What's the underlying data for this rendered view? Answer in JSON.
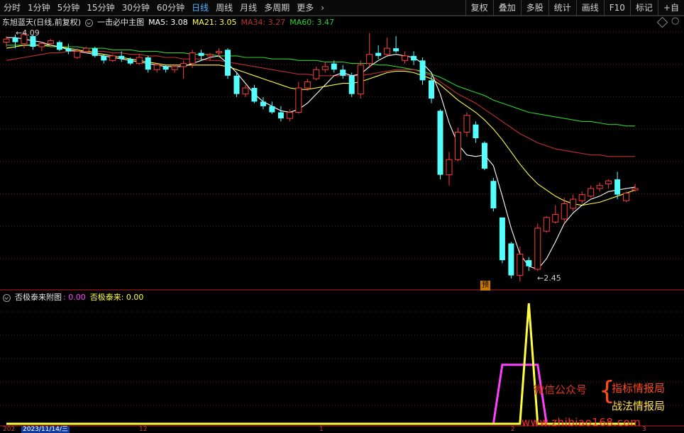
{
  "toolbar": {
    "periods": [
      "分时",
      "1分钟",
      "5分钟",
      "15分钟",
      "30分钟",
      "60分钟",
      "日线",
      "周线",
      "月线",
      "多周期",
      "更多"
    ],
    "active_period": "日线",
    "right_buttons": [
      "复权",
      "叠加",
      "多股",
      "统计",
      "画线",
      "F10",
      "标记",
      "+自"
    ]
  },
  "main_info": {
    "stock": "东旭蓝天(日线,前复权)",
    "indicator": "一击必中主图",
    "ma5": "MA5: 3.08",
    "ma21": "MA21: 3.05",
    "ma34": "MA34: 3.27",
    "ma60": "MA60: 3.47",
    "high_label": "4.09",
    "low_label": "2.45",
    "pre_badge": "预",
    "colors": {
      "ma5": "#ffffff",
      "ma21": "#ffff40",
      "ma34": "#c03030",
      "ma60": "#30d030"
    }
  },
  "sub_info": {
    "title": "否极泰来附图",
    "v1": ": 0.00",
    "v2_label": "否极泰来",
    "v2": ": 0.00",
    "colors": {
      "v1": "#ff40ff",
      "v2": "#ffff40"
    }
  },
  "watermark": {
    "wechat": "微信公众号",
    "l1": "指标情报局",
    "l2": "战法情报局",
    "url": "www.zhibiao168.com"
  },
  "axis": {
    "date_cursor": "2023/11/14/三",
    "partial_year": "202",
    "x_labels": [
      "12",
      "1",
      "2",
      "3"
    ]
  },
  "chart_data": {
    "type": "candlestick",
    "candles": [
      [
        4.02,
        4.06,
        3.99,
        4.04
      ],
      [
        4.05,
        4.07,
        3.98,
        4.02
      ],
      [
        4.01,
        4.09,
        3.98,
        4.07
      ],
      [
        4.06,
        4.07,
        3.97,
        3.99
      ],
      [
        3.99,
        4.02,
        3.96,
        4.01
      ],
      [
        4.01,
        4.04,
        3.99,
        4.03
      ],
      [
        4.02,
        4.03,
        3.96,
        3.97
      ],
      [
        3.98,
        4.01,
        3.94,
        3.96
      ],
      [
        3.92,
        3.98,
        3.91,
        3.96
      ],
      [
        3.96,
        3.99,
        3.95,
        3.98
      ],
      [
        3.98,
        3.99,
        3.92,
        3.93
      ],
      [
        3.93,
        3.94,
        3.88,
        3.9
      ],
      [
        3.9,
        3.94,
        3.89,
        3.93
      ],
      [
        3.93,
        3.96,
        3.89,
        3.91
      ],
      [
        3.91,
        3.92,
        3.87,
        3.88
      ],
      [
        3.88,
        3.94,
        3.87,
        3.92
      ],
      [
        3.92,
        3.93,
        3.82,
        3.84
      ],
      [
        3.84,
        3.88,
        3.82,
        3.87
      ],
      [
        3.86,
        3.87,
        3.82,
        3.84
      ],
      [
        3.84,
        3.87,
        3.82,
        3.86
      ],
      [
        3.86,
        3.9,
        3.78,
        3.88
      ],
      [
        3.88,
        3.97,
        3.85,
        3.95
      ],
      [
        3.95,
        3.97,
        3.9,
        3.93
      ],
      [
        3.93,
        3.95,
        3.9,
        3.94
      ],
      [
        3.95,
        3.98,
        3.92,
        3.96
      ],
      [
        3.97,
        3.98,
        3.78,
        3.8
      ],
      [
        3.8,
        3.82,
        3.66,
        3.68
      ],
      [
        3.68,
        3.74,
        3.66,
        3.72
      ],
      [
        3.72,
        3.74,
        3.62,
        3.63
      ],
      [
        3.63,
        3.66,
        3.58,
        3.6
      ],
      [
        3.6,
        3.63,
        3.55,
        3.56
      ],
      [
        3.56,
        3.6,
        3.5,
        3.52
      ],
      [
        3.52,
        3.58,
        3.5,
        3.56
      ],
      [
        3.56,
        3.76,
        3.55,
        3.72
      ],
      [
        3.72,
        3.78,
        3.7,
        3.76
      ],
      [
        3.78,
        3.86,
        3.77,
        3.84
      ],
      [
        3.84,
        3.89,
        3.82,
        3.86
      ],
      [
        3.88,
        3.9,
        3.82,
        3.84
      ],
      [
        3.84,
        3.87,
        3.78,
        3.8
      ],
      [
        3.8,
        3.82,
        3.66,
        3.68
      ],
      [
        3.68,
        3.9,
        3.65,
        3.87
      ],
      [
        3.88,
        4.08,
        3.85,
        3.94
      ],
      [
        3.95,
        4.0,
        3.91,
        3.93
      ],
      [
        3.94,
        4.05,
        3.93,
        3.98
      ],
      [
        3.98,
        4.06,
        3.95,
        3.96
      ],
      [
        3.9,
        3.96,
        3.88,
        3.93
      ],
      [
        3.93,
        3.96,
        3.87,
        3.9
      ],
      [
        3.9,
        3.92,
        3.74,
        3.77
      ],
      [
        3.77,
        3.8,
        3.62,
        3.65
      ],
      [
        3.57,
        3.58,
        3.12,
        3.15
      ],
      [
        3.15,
        3.3,
        3.08,
        3.25
      ],
      [
        3.25,
        3.46,
        3.24,
        3.43
      ],
      [
        3.43,
        3.56,
        3.4,
        3.54
      ],
      [
        3.48,
        3.5,
        3.36,
        3.39
      ],
      [
        3.36,
        3.37,
        3.18,
        3.19
      ],
      [
        3.11,
        3.13,
        2.91,
        2.93
      ],
      [
        2.87,
        2.87,
        2.57,
        2.59
      ],
      [
        2.7,
        2.71,
        2.47,
        2.49
      ],
      [
        2.49,
        2.68,
        2.45,
        2.63
      ],
      [
        2.59,
        2.61,
        2.52,
        2.55
      ],
      [
        2.53,
        2.83,
        2.52,
        2.8
      ],
      [
        2.78,
        2.88,
        2.77,
        2.87
      ],
      [
        2.84,
        2.95,
        2.83,
        2.89
      ],
      [
        2.86,
        3.0,
        2.84,
        2.96
      ],
      [
        2.93,
        3.02,
        2.91,
        2.99
      ],
      [
        2.98,
        3.04,
        2.96,
        3.02
      ],
      [
        3.01,
        3.08,
        3.0,
        3.06
      ],
      [
        3.06,
        3.1,
        3.04,
        3.08
      ],
      [
        3.09,
        3.12,
        3.06,
        3.11
      ],
      [
        3.12,
        3.17,
        2.99,
        3.02
      ],
      [
        2.98,
        3.04,
        2.97,
        3.03
      ],
      [
        3.05,
        3.09,
        3.04,
        3.06
      ]
    ],
    "ma5": [
      4.05,
      4.05,
      4.04,
      4.03,
      4.02,
      4.0,
      3.99,
      3.97,
      3.96,
      3.95,
      3.94,
      3.93,
      3.92,
      3.91,
      3.9,
      3.89,
      3.88,
      3.87,
      3.86,
      3.86,
      3.86,
      3.88,
      3.9,
      3.92,
      3.93,
      3.88,
      3.82,
      3.75,
      3.68,
      3.63,
      3.6,
      3.57,
      3.56,
      3.58,
      3.62,
      3.68,
      3.74,
      3.8,
      3.82,
      3.8,
      3.81,
      3.86,
      3.9,
      3.93,
      3.94,
      3.93,
      3.92,
      3.88,
      3.82,
      3.68,
      3.49,
      3.35,
      3.28,
      3.27,
      3.28,
      3.21,
      3.01,
      2.8,
      2.63,
      2.55,
      2.53,
      2.6,
      2.71,
      2.83,
      2.9,
      2.95,
      2.99,
      3.01,
      3.04,
      3.05,
      3.06,
      3.07
    ],
    "ma21": [
      3.98,
      3.99,
      4.0,
      4.0,
      4.0,
      4.0,
      3.99,
      3.98,
      3.97,
      3.96,
      3.95,
      3.94,
      3.93,
      3.92,
      3.91,
      3.9,
      3.89,
      3.88,
      3.87,
      3.87,
      3.87,
      3.87,
      3.87,
      3.87,
      3.87,
      3.86,
      3.84,
      3.82,
      3.8,
      3.78,
      3.76,
      3.74,
      3.72,
      3.71,
      3.71,
      3.72,
      3.73,
      3.74,
      3.75,
      3.75,
      3.76,
      3.78,
      3.8,
      3.82,
      3.83,
      3.83,
      3.82,
      3.8,
      3.78,
      3.74,
      3.69,
      3.64,
      3.6,
      3.56,
      3.51,
      3.45,
      3.38,
      3.3,
      3.22,
      3.15,
      3.09,
      3.05,
      3.01,
      2.98,
      2.96,
      2.95,
      2.96,
      2.97,
      2.99,
      3.01,
      3.03,
      3.05
    ],
    "ma34": [
      3.9,
      3.91,
      3.92,
      3.93,
      3.94,
      3.95,
      3.95,
      3.96,
      3.96,
      3.96,
      3.96,
      3.96,
      3.95,
      3.95,
      3.94,
      3.94,
      3.93,
      3.93,
      3.92,
      3.92,
      3.91,
      3.91,
      3.91,
      3.9,
      3.9,
      3.89,
      3.88,
      3.87,
      3.86,
      3.85,
      3.84,
      3.83,
      3.82,
      3.81,
      3.81,
      3.8,
      3.8,
      3.8,
      3.8,
      3.8,
      3.8,
      3.81,
      3.82,
      3.83,
      3.84,
      3.84,
      3.84,
      3.82,
      3.8,
      3.76,
      3.72,
      3.68,
      3.65,
      3.62,
      3.58,
      3.54,
      3.5,
      3.46,
      3.42,
      3.39,
      3.36,
      3.34,
      3.32,
      3.31,
      3.3,
      3.29,
      3.28,
      3.28,
      3.27,
      3.27,
      3.27,
      3.27
    ],
    "ma60": [
      4.0,
      4.0,
      4.0,
      4.0,
      4.0,
      3.99,
      3.99,
      3.99,
      3.99,
      3.98,
      3.98,
      3.98,
      3.97,
      3.97,
      3.97,
      3.96,
      3.96,
      3.96,
      3.95,
      3.95,
      3.95,
      3.94,
      3.94,
      3.94,
      3.93,
      3.93,
      3.93,
      3.92,
      3.92,
      3.92,
      3.91,
      3.91,
      3.91,
      3.9,
      3.9,
      3.9,
      3.89,
      3.89,
      3.89,
      3.88,
      3.88,
      3.88,
      3.87,
      3.87,
      3.86,
      3.85,
      3.84,
      3.83,
      3.81,
      3.79,
      3.76,
      3.73,
      3.71,
      3.69,
      3.67,
      3.64,
      3.62,
      3.6,
      3.58,
      3.56,
      3.55,
      3.54,
      3.53,
      3.52,
      3.51,
      3.5,
      3.5,
      3.49,
      3.48,
      3.48,
      3.47,
      3.47
    ],
    "sub": {
      "magenta": [
        0,
        0,
        0,
        0,
        0,
        0,
        0,
        0,
        0,
        0,
        0,
        0,
        0,
        0,
        0,
        0,
        0,
        0,
        0,
        0,
        0,
        0,
        0,
        0,
        0,
        0,
        0,
        0,
        0,
        0,
        0,
        0,
        0,
        0,
        0,
        0,
        0,
        0,
        0,
        0,
        0,
        0,
        0,
        0,
        0,
        0,
        0,
        0,
        0,
        0,
        0,
        0,
        0,
        0,
        0,
        0,
        0.49,
        0.49,
        0.49,
        0.49,
        0.49,
        0,
        0,
        0,
        0,
        0,
        0,
        0,
        0,
        0,
        0,
        0
      ],
      "yellow": [
        0,
        0,
        0,
        0,
        0,
        0,
        0,
        0,
        0,
        0,
        0,
        0,
        0,
        0,
        0,
        0,
        0,
        0,
        0,
        0,
        0,
        0,
        0,
        0,
        0,
        0,
        0,
        0,
        0,
        0,
        0,
        0,
        0,
        0,
        0,
        0,
        0,
        0,
        0,
        0,
        0,
        0,
        0,
        0,
        0,
        0,
        0,
        0,
        0,
        0,
        0,
        0,
        0,
        0,
        0,
        0,
        0,
        0,
        0,
        1,
        0,
        0,
        0,
        0,
        0,
        0,
        0,
        0,
        0,
        0,
        0,
        0
      ]
    }
  }
}
